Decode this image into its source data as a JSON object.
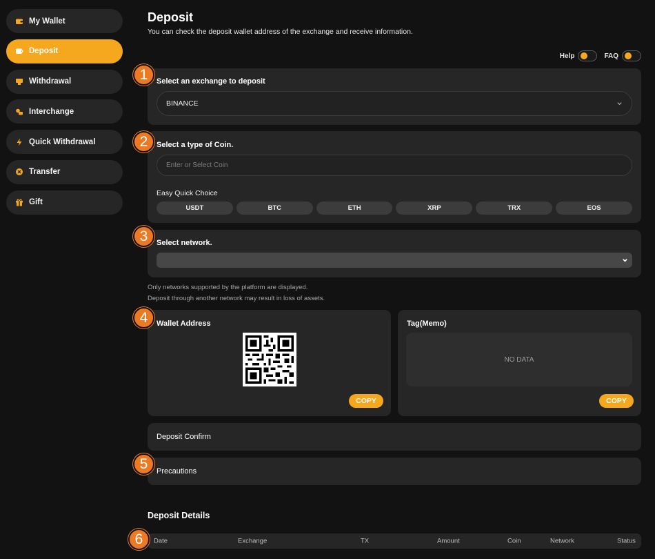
{
  "sidebar": {
    "items": [
      {
        "label": "My Wallet",
        "icon": "wallet-icon",
        "active": false
      },
      {
        "label": "Deposit",
        "icon": "deposit-icon",
        "active": true
      },
      {
        "label": "Withdrawal",
        "icon": "withdrawal-icon",
        "active": false
      },
      {
        "label": "Interchange",
        "icon": "interchange-icon",
        "active": false
      },
      {
        "label": "Quick Withdrawal",
        "icon": "lightning-icon",
        "active": false
      },
      {
        "label": "Transfer",
        "icon": "transfer-icon",
        "active": false
      },
      {
        "label": "Gift",
        "icon": "gift-icon",
        "active": false
      }
    ]
  },
  "header": {
    "title": "Deposit",
    "subtitle": "You can check the deposit wallet address of the exchange and receive information."
  },
  "toggles": {
    "help_label": "Help",
    "faq_label": "FAQ"
  },
  "exchange": {
    "title": "Select an exchange to deposit",
    "selected": "BINANCE"
  },
  "coin": {
    "title": "Select a type of Coin.",
    "placeholder": "Enter or Select Coin",
    "quick_label": "Easy Quick Choice",
    "quick": [
      "USDT",
      "BTC",
      "ETH",
      "XRP",
      "TRX",
      "EOS"
    ]
  },
  "network": {
    "title": "Select network.",
    "selected": "",
    "note_1": "Only networks supported by the platform are displayed.",
    "note_2": "Deposit through another network may result in loss of assets."
  },
  "wallet": {
    "title": "Wallet Address",
    "copy_label": "COPY"
  },
  "tag": {
    "title": "Tag(Memo)",
    "empty_label": "NO DATA",
    "copy_label": "COPY"
  },
  "confirm": {
    "label": "Deposit Confirm"
  },
  "precautions": {
    "label": "Precautions"
  },
  "details": {
    "title": "Deposit Details",
    "columns": [
      "Date",
      "Exchange",
      "TX",
      "Amount",
      "Coin",
      "Network",
      "Status"
    ]
  },
  "steps": [
    "1",
    "2",
    "3",
    "4",
    "5",
    "6"
  ],
  "colors": {
    "accent": "#f5a81d",
    "step": "#ed7a22",
    "card": "#262626",
    "background": "#121212"
  }
}
